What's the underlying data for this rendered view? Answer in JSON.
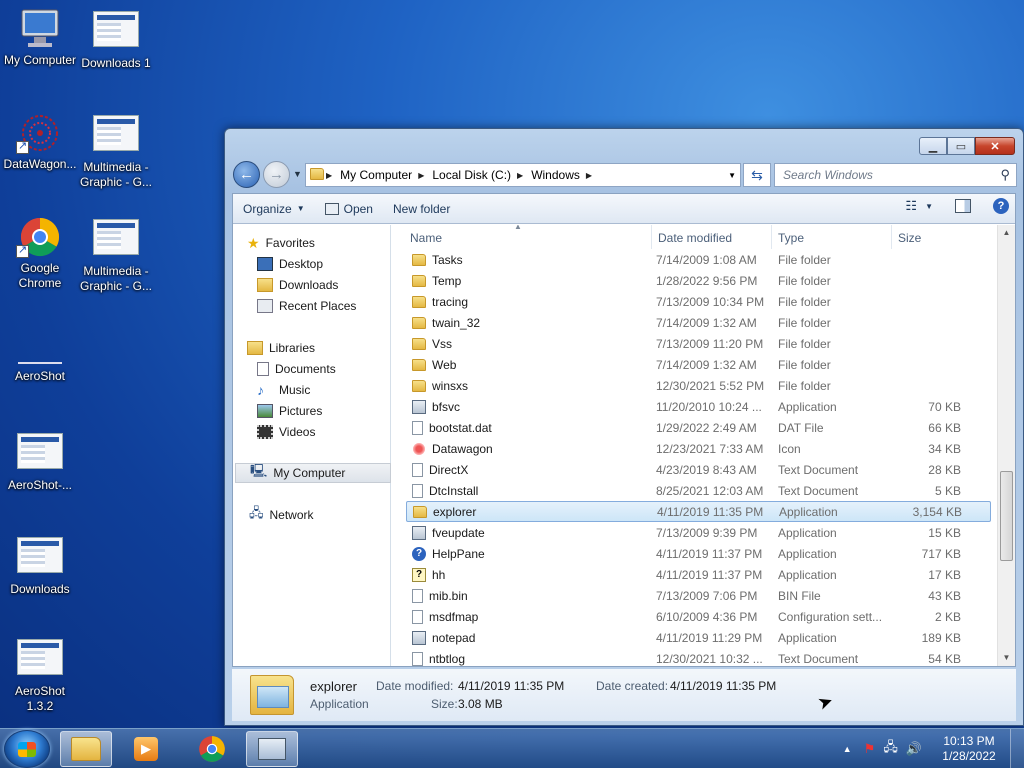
{
  "desktop": {
    "icons": [
      {
        "label": "My Computer"
      },
      {
        "label": "Downloads 1"
      },
      {
        "label": "DataWagon..."
      },
      {
        "label": "Multimedia - Graphic - G..."
      },
      {
        "label": "Google Chrome"
      },
      {
        "label": "Multimedia - Graphic - G..."
      },
      {
        "label": "AeroShot"
      },
      {
        "label": "AeroShot-..."
      },
      {
        "label": "Downloads"
      },
      {
        "label": "AeroShot 1.3.2"
      }
    ]
  },
  "window": {
    "address": {
      "crumbs": [
        "My Computer",
        "Local Disk (C:)",
        "Windows"
      ]
    },
    "search": {
      "placeholder": "Search Windows"
    },
    "toolbar": {
      "organize": "Organize",
      "open": "Open",
      "new_folder": "New folder"
    },
    "navpane": {
      "favorites": "Favorites",
      "desktop": "Desktop",
      "downloads": "Downloads",
      "recent": "Recent Places",
      "libraries": "Libraries",
      "documents": "Documents",
      "music": "Music",
      "pictures": "Pictures",
      "videos": "Videos",
      "my_computer": "My Computer",
      "network": "Network"
    },
    "columns": {
      "name": "Name",
      "date": "Date modified",
      "type": "Type",
      "size": "Size"
    },
    "files": [
      {
        "name": "Tasks",
        "date": "7/14/2009 1:08 AM",
        "type": "File folder",
        "size": "",
        "icon": "folder"
      },
      {
        "name": "Temp",
        "date": "1/28/2022 9:56 PM",
        "type": "File folder",
        "size": "",
        "icon": "folder"
      },
      {
        "name": "tracing",
        "date": "7/13/2009 10:34 PM",
        "type": "File folder",
        "size": "",
        "icon": "folder"
      },
      {
        "name": "twain_32",
        "date": "7/14/2009 1:32 AM",
        "type": "File folder",
        "size": "",
        "icon": "folder"
      },
      {
        "name": "Vss",
        "date": "7/13/2009 11:20 PM",
        "type": "File folder",
        "size": "",
        "icon": "folder"
      },
      {
        "name": "Web",
        "date": "7/14/2009 1:32 AM",
        "type": "File folder",
        "size": "",
        "icon": "folder"
      },
      {
        "name": "winsxs",
        "date": "12/30/2021 5:52 PM",
        "type": "File folder",
        "size": "",
        "icon": "folder"
      },
      {
        "name": "bfsvc",
        "date": "11/20/2010 10:24 ...",
        "type": "Application",
        "size": "70 KB",
        "icon": "app"
      },
      {
        "name": "bootstat.dat",
        "date": "1/29/2022 2:49 AM",
        "type": "DAT File",
        "size": "66 KB",
        "icon": "doc"
      },
      {
        "name": "Datawagon",
        "date": "12/23/2021 7:33 AM",
        "type": "Icon",
        "size": "34 KB",
        "icon": "ico"
      },
      {
        "name": "DirectX",
        "date": "4/23/2019 8:43 AM",
        "type": "Text Document",
        "size": "28 KB",
        "icon": "doc"
      },
      {
        "name": "DtcInstall",
        "date": "8/25/2021 12:03 AM",
        "type": "Text Document",
        "size": "5 KB",
        "icon": "doc"
      },
      {
        "name": "explorer",
        "date": "4/11/2019 11:35 PM",
        "type": "Application",
        "size": "3,154 KB",
        "icon": "folder",
        "selected": true
      },
      {
        "name": "fveupdate",
        "date": "7/13/2009 9:39 PM",
        "type": "Application",
        "size": "15 KB",
        "icon": "app"
      },
      {
        "name": "HelpPane",
        "date": "4/11/2019 11:37 PM",
        "type": "Application",
        "size": "717 KB",
        "icon": "help"
      },
      {
        "name": "hh",
        "date": "4/11/2019 11:37 PM",
        "type": "Application",
        "size": "17 KB",
        "icon": "hh"
      },
      {
        "name": "mib.bin",
        "date": "7/13/2009 7:06 PM",
        "type": "BIN File",
        "size": "43 KB",
        "icon": "doc"
      },
      {
        "name": "msdfmap",
        "date": "6/10/2009 4:36 PM",
        "type": "Configuration sett...",
        "size": "2 KB",
        "icon": "doc"
      },
      {
        "name": "notepad",
        "date": "4/11/2019 11:29 PM",
        "type": "Application",
        "size": "189 KB",
        "icon": "app"
      },
      {
        "name": "ntbtlog",
        "date": "12/30/2021 10:32 ...",
        "type": "Text Document",
        "size": "54 KB",
        "icon": "doc"
      }
    ],
    "details": {
      "name": "explorer",
      "type": "Application",
      "date_modified_label": "Date modified:",
      "date_modified": "4/11/2019 11:35 PM",
      "date_created_label": "Date created:",
      "date_created": "4/11/2019 11:35 PM",
      "size_label": "Size:",
      "size": "3.08 MB"
    }
  },
  "taskbar": {
    "time": "10:13 PM",
    "date": "1/28/2022"
  }
}
